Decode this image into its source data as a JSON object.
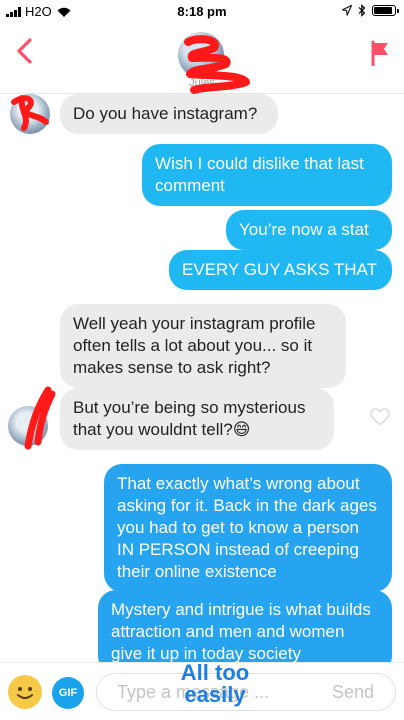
{
  "status_bar": {
    "carrier": "H2O",
    "time": "8:18 pm",
    "battery_level": 0.9
  },
  "header": {
    "contact_name": "Jules",
    "back_icon": "chevron-left-icon",
    "report_icon": "flag-icon"
  },
  "messages": [
    {
      "direction": "incoming",
      "text": "Do you have instagram?"
    },
    {
      "direction": "outgoing",
      "text": "Wish I could dislike that last comment"
    },
    {
      "direction": "outgoing",
      "text": "You’re now a stat"
    },
    {
      "direction": "outgoing",
      "text": "EVERY GUY ASKS THAT"
    },
    {
      "direction": "incoming",
      "text": "Well yeah your instagram profile often tells a lot about you... so it makes sense to ask right?"
    },
    {
      "direction": "incoming",
      "text": "But you’re being so mysterious that you wouldnt tell?😄"
    },
    {
      "direction": "outgoing",
      "text": "That exactly what’s wrong about asking for it. Back in the dark ages you had to get to know a person IN PERSON instead of creeping their online existence"
    },
    {
      "direction": "outgoing",
      "text": "Mystery and intrigue is what builds attraction and men and women give it up in today society"
    }
  ],
  "input_bar": {
    "emoji_icon": "smiley-face-icon",
    "gif_label": "GIF",
    "placeholder": "Type a message ...",
    "send_label": "Send"
  },
  "overlay_caption": "All too easily",
  "colors": {
    "outgoing": "#1fb8f2",
    "incoming": "#ebebeb",
    "accent": "#fd5068"
  }
}
